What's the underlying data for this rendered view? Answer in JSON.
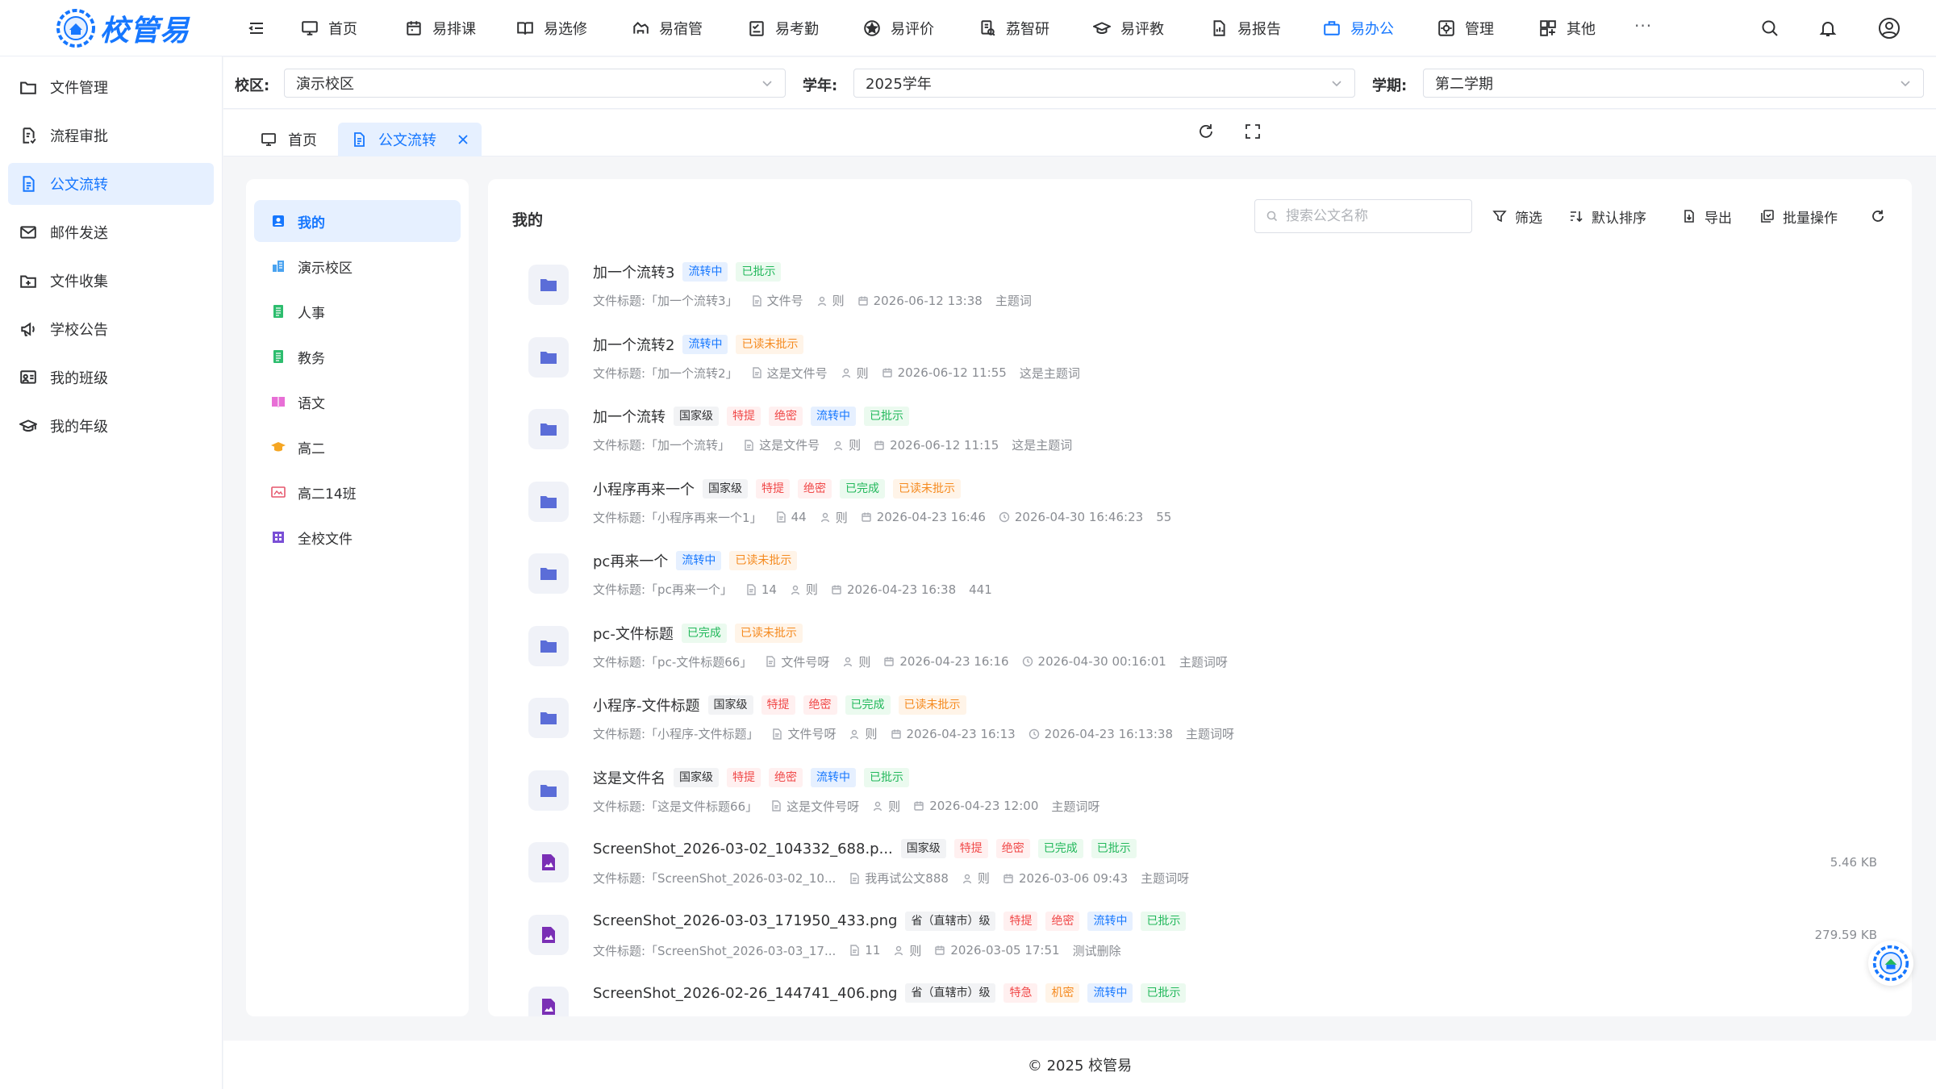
{
  "app": {
    "name": "校管易"
  },
  "topnav": {
    "items": [
      {
        "label": "首页",
        "icon": "monitor-icon"
      },
      {
        "label": "易排课",
        "icon": "calendar-icon"
      },
      {
        "label": "易选修",
        "icon": "book-icon"
      },
      {
        "label": "易宿管",
        "icon": "bed-icon"
      },
      {
        "label": "易考勤",
        "icon": "checklist-icon"
      },
      {
        "label": "易评价",
        "icon": "star-icon"
      },
      {
        "label": "荔智研",
        "icon": "research-icon"
      },
      {
        "label": "易评教",
        "icon": "mortarboard-icon"
      },
      {
        "label": "易报告",
        "icon": "report-icon"
      },
      {
        "label": "易办公",
        "icon": "briefcase-icon"
      },
      {
        "label": "管理",
        "icon": "settings-box-icon"
      },
      {
        "label": "其他",
        "icon": "grid-icon"
      }
    ],
    "more": "···",
    "active": "易办公"
  },
  "sidebar": {
    "items": [
      {
        "label": "文件管理",
        "icon": "folder-icon"
      },
      {
        "label": "流程审批",
        "icon": "approval-icon"
      },
      {
        "label": "公文流转",
        "icon": "document-icon"
      },
      {
        "label": "邮件发送",
        "icon": "mail-icon"
      },
      {
        "label": "文件收集",
        "icon": "folder-add-icon"
      },
      {
        "label": "学校公告",
        "icon": "megaphone-icon"
      },
      {
        "label": "我的班级",
        "icon": "class-icon"
      },
      {
        "label": "我的年级",
        "icon": "grade-icon"
      }
    ],
    "active": "公文流转"
  },
  "filters": {
    "campus": {
      "label": "校区:",
      "value": "演示校区"
    },
    "year": {
      "label": "学年:",
      "value": "2025学年"
    },
    "term": {
      "label": "学期:",
      "value": "第二学期"
    }
  },
  "tabs": [
    {
      "label": "首页"
    },
    {
      "label": "公文流转",
      "closable": true
    }
  ],
  "categories": [
    {
      "label": "我的",
      "color": "#1677ff"
    },
    {
      "label": "演示校区",
      "color": "#4aa3f0"
    },
    {
      "label": "人事",
      "color": "#2dbd6e"
    },
    {
      "label": "教务",
      "color": "#2dbd6e"
    },
    {
      "label": "语文",
      "color": "#e86fd6"
    },
    {
      "label": "高二",
      "color": "#f5a623"
    },
    {
      "label": "高二14班",
      "color": "#e5566c"
    },
    {
      "label": "全校文件",
      "color": "#7a4fd6"
    }
  ],
  "main": {
    "title": "我的",
    "search_placeholder": "搜索公文名称",
    "tools": {
      "filter": "筛选",
      "sort": "默认排序",
      "export": "导出",
      "batch": "批量操作"
    }
  },
  "documents": [
    {
      "name": "加一个流转3",
      "type": "folder",
      "tags": [
        [
          "流转中",
          "blue"
        ],
        [
          "已批示",
          "green"
        ]
      ],
      "meta": [
        "文件标题:「加一个流转3」",
        "文件号",
        "则",
        "2026-06-12 13:38",
        "主题词"
      ]
    },
    {
      "name": "加一个流转2",
      "type": "folder",
      "tags": [
        [
          "流转中",
          "blue"
        ],
        [
          "已读未批示",
          "orange"
        ]
      ],
      "meta": [
        "文件标题:「加一个流转2」",
        "这是文件号",
        "则",
        "2026-06-12 11:55",
        "这是主题词"
      ]
    },
    {
      "name": "加一个流转",
      "type": "folder",
      "tags": [
        [
          "国家级",
          "gray"
        ],
        [
          "特提",
          "red"
        ],
        [
          "绝密",
          "red"
        ],
        [
          "流转中",
          "blue"
        ],
        [
          "已批示",
          "green"
        ]
      ],
      "meta": [
        "文件标题:「加一个流转」",
        "这是文件号",
        "则",
        "2026-06-12 11:15",
        "这是主题词"
      ]
    },
    {
      "name": "小程序再来一个",
      "type": "folder",
      "tags": [
        [
          "国家级",
          "gray"
        ],
        [
          "特提",
          "red"
        ],
        [
          "绝密",
          "red"
        ],
        [
          "已完成",
          "green"
        ],
        [
          "已读未批示",
          "orange"
        ]
      ],
      "meta": [
        "文件标题:「小程序再来一个1」",
        "44",
        "则",
        "2026-04-23 16:46",
        "2026-04-30 16:46:23",
        "55"
      ]
    },
    {
      "name": "pc再来一个",
      "type": "folder",
      "tags": [
        [
          "流转中",
          "blue"
        ],
        [
          "已读未批示",
          "orange"
        ]
      ],
      "meta": [
        "文件标题:「pc再来一个」",
        "14",
        "则",
        "2026-04-23 16:38",
        "441"
      ]
    },
    {
      "name": "pc-文件标题",
      "type": "folder",
      "tags": [
        [
          "已完成",
          "green"
        ],
        [
          "已读未批示",
          "orange"
        ]
      ],
      "meta": [
        "文件标题:「pc-文件标题66」",
        "文件号呀",
        "则",
        "2026-04-23 16:16",
        "2026-04-30 00:16:01",
        "主题词呀"
      ]
    },
    {
      "name": "小程序-文件标题",
      "type": "folder",
      "tags": [
        [
          "国家级",
          "gray"
        ],
        [
          "特提",
          "red"
        ],
        [
          "绝密",
          "red"
        ],
        [
          "已完成",
          "green"
        ],
        [
          "已读未批示",
          "orange"
        ]
      ],
      "meta": [
        "文件标题:「小程序-文件标题」",
        "文件号呀",
        "则",
        "2026-04-23 16:13",
        "2026-04-23 16:13:38",
        "主题词呀"
      ]
    },
    {
      "name": "这是文件名",
      "type": "folder",
      "tags": [
        [
          "国家级",
          "gray"
        ],
        [
          "特提",
          "red"
        ],
        [
          "绝密",
          "red"
        ],
        [
          "流转中",
          "blue"
        ],
        [
          "已批示",
          "green"
        ]
      ],
      "meta": [
        "文件标题:「这是文件标题66」",
        "这是文件号呀",
        "则",
        "2026-04-23 12:00",
        "主题词呀"
      ]
    },
    {
      "name": "ScreenShot_2026-03-02_104332_688.p...",
      "type": "image",
      "size": "5.46 KB",
      "tags": [
        [
          "国家级",
          "gray"
        ],
        [
          "特提",
          "red"
        ],
        [
          "绝密",
          "red"
        ],
        [
          "已完成",
          "green"
        ],
        [
          "已批示",
          "green"
        ]
      ],
      "meta": [
        "文件标题:「ScreenShot_2026-03-02_10...",
        "我再试公文888",
        "则",
        "2026-03-06 09:43",
        "主题词呀"
      ]
    },
    {
      "name": "ScreenShot_2026-03-03_171950_433.png",
      "type": "image",
      "size": "279.59 KB",
      "tags": [
        [
          "省（直辖市）级",
          "gray"
        ],
        [
          "特提",
          "red"
        ],
        [
          "绝密",
          "red"
        ],
        [
          "流转中",
          "blue"
        ],
        [
          "已批示",
          "green"
        ]
      ],
      "meta": [
        "文件标题:「ScreenShot_2026-03-03_17...",
        "11",
        "则",
        "2026-03-05 17:51",
        "测试删除"
      ]
    },
    {
      "name": "ScreenShot_2026-02-26_144741_406.png",
      "type": "image",
      "size": "",
      "tags": [
        [
          "省（直辖市）级",
          "gray"
        ],
        [
          "特急",
          "red"
        ],
        [
          "机密",
          "orange"
        ],
        [
          "流转中",
          "blue"
        ],
        [
          "已批示",
          "green"
        ]
      ],
      "meta": []
    }
  ],
  "footer": "© 2025 校管易"
}
